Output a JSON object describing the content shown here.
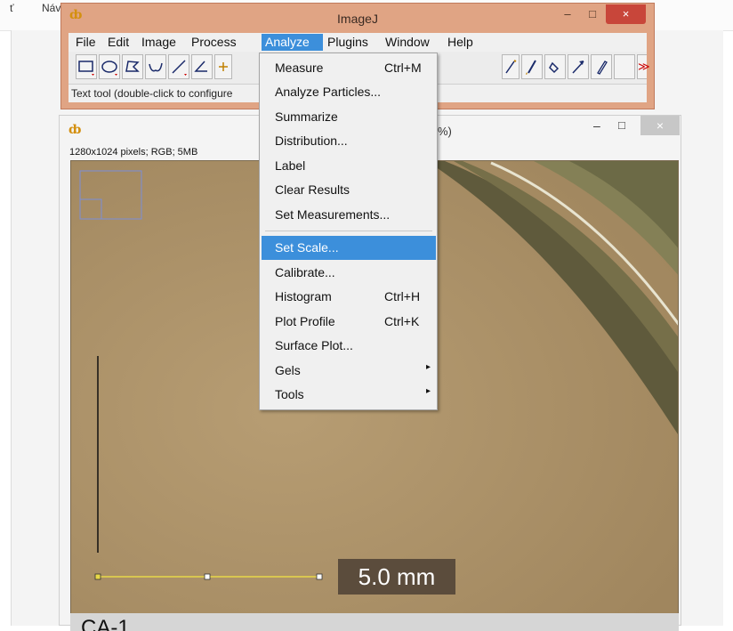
{
  "background": {
    "left_labels": [
      "ť",
      "Náv"
    ]
  },
  "imagej": {
    "title": "ImageJ",
    "window_buttons": {
      "minimize": "–",
      "maximize": "□",
      "close": "×"
    },
    "menu": [
      "File",
      "Edit",
      "Image",
      "Process",
      "Analyze",
      "Plugins",
      "Window",
      "Help"
    ],
    "active_menu": "Analyze",
    "status": "Text tool (double-click to configure",
    "toolbar_more": "≫"
  },
  "image_window": {
    "title_fragment": "%)",
    "info": "1280x1024 pixels; RGB; 5MB",
    "scale_label": "5.0 mm",
    "bottom_label": "CA-1",
    "window_buttons": {
      "minimize": "–",
      "maximize": "□",
      "close": "×"
    }
  },
  "analyze_menu": {
    "items": [
      {
        "label": "Measure",
        "shortcut": "Ctrl+M"
      },
      {
        "label": "Analyze Particles...",
        "shortcut": ""
      },
      {
        "label": "Summarize",
        "shortcut": ""
      },
      {
        "label": "Distribution...",
        "shortcut": ""
      },
      {
        "label": "Label",
        "shortcut": ""
      },
      {
        "label": "Clear Results",
        "shortcut": ""
      },
      {
        "label": "Set Measurements...",
        "shortcut": ""
      },
      {
        "label": "Set Scale...",
        "shortcut": "",
        "selected": true
      },
      {
        "label": "Calibrate...",
        "shortcut": ""
      },
      {
        "label": "Histogram",
        "shortcut": "Ctrl+H"
      },
      {
        "label": "Plot Profile",
        "shortcut": "Ctrl+K"
      },
      {
        "label": "Surface Plot...",
        "shortcut": ""
      },
      {
        "label": "Gels",
        "shortcut": "",
        "submenu": true
      },
      {
        "label": "Tools",
        "shortcut": "",
        "submenu": true
      }
    ],
    "submenu_arrow": "▸"
  },
  "colors": {
    "window_frame": "#e0a484",
    "menu_highlight": "#3c8fdb",
    "close_button": "#c8463a",
    "image_background": "#ab9168"
  }
}
